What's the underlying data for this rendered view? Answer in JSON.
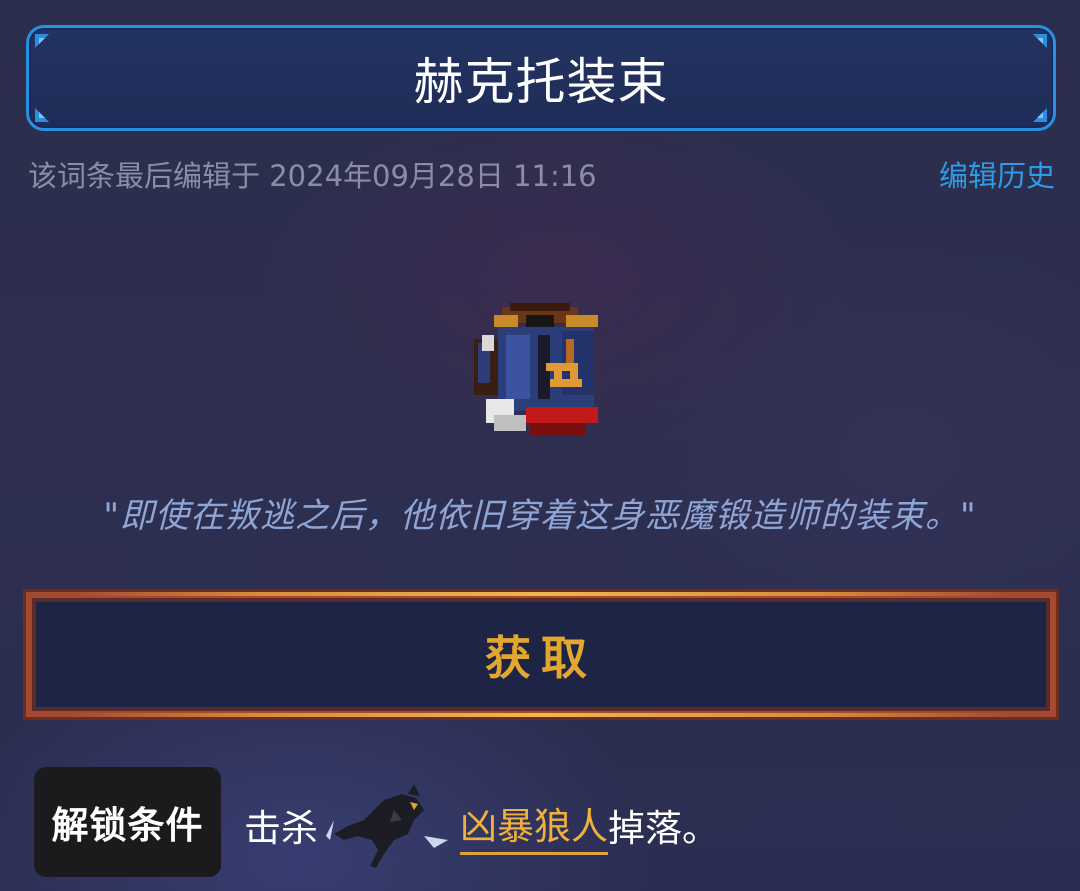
{
  "header": {
    "title": "赫克托装束"
  },
  "meta": {
    "last_edited": "该词条最后编辑于 2024年09月28日 11:16",
    "edit_history_label": "编辑历史"
  },
  "item": {
    "icon": "outfit-icon",
    "quote": "\"即使在叛逃之后，他依旧穿着这身恶魔锻造师的装束。\""
  },
  "obtain_button": {
    "label": "获取"
  },
  "unlock": {
    "badge_label": "解锁条件",
    "prefix": "击杀",
    "monster_icon": "werewolf-icon",
    "monster_name": "凶暴狼人",
    "suffix": "掉落。"
  },
  "colors": {
    "accent_blue": "#2a8fe0",
    "link_blue": "#2f9be6",
    "gold": "#e3a72f",
    "button_border": "#a44a31"
  }
}
